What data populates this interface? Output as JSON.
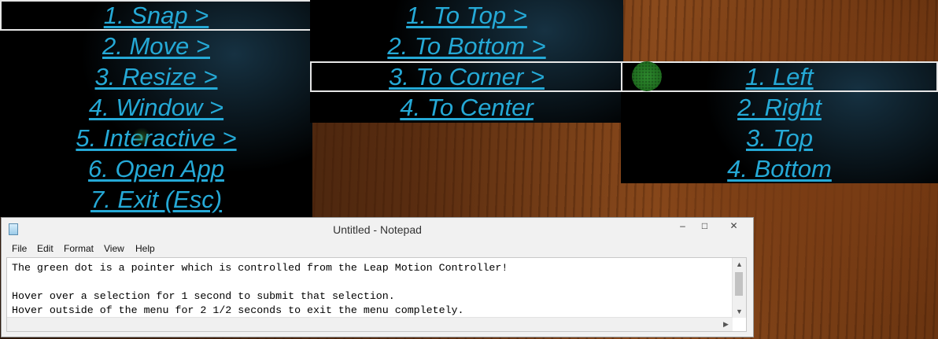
{
  "menu_level_1": {
    "items": [
      {
        "label": "1. Snap >",
        "selected": true
      },
      {
        "label": "2. Move >",
        "selected": false
      },
      {
        "label": "3. Resize >",
        "selected": false
      },
      {
        "label": "4. Window >",
        "selected": false
      },
      {
        "label": "5. Interactive >",
        "selected": false
      },
      {
        "label": "6. Open App",
        "selected": false
      },
      {
        "label": "7. Exit (Esc)",
        "selected": false
      }
    ]
  },
  "menu_level_2": {
    "items": [
      {
        "label": "1. To Top >",
        "selected": false
      },
      {
        "label": "2. To Bottom >",
        "selected": false
      },
      {
        "label": "3. To Corner >",
        "selected": true
      },
      {
        "label": "4. To Center",
        "selected": false
      }
    ]
  },
  "menu_level_3": {
    "items": [
      {
        "label": "1. Left",
        "selected": true
      },
      {
        "label": "2. Right",
        "selected": false
      },
      {
        "label": "3. Top",
        "selected": false
      },
      {
        "label": "4. Bottom",
        "selected": false
      }
    ]
  },
  "pointer": {
    "icon": "green-dot-pointer-icon",
    "color": "#1e6a1e"
  },
  "notepad": {
    "title": "Untitled - Notepad",
    "menus": [
      "File",
      "Edit",
      "Format",
      "View",
      "Help"
    ],
    "controls": {
      "minimize": "‒",
      "maximize": "□",
      "close": "✕"
    },
    "text_lines": [
      "The green dot is a pointer which is controlled from the Leap Motion Controller!",
      "",
      "Hover over a selection for 1 second to submit that selection.",
      "Hover outside of the menu for 2 1/2 seconds to exit the menu completely."
    ]
  },
  "colors": {
    "menu_text": "#25a9d6",
    "menu_bg": "#000000",
    "selection_border": "#e6e6e6"
  }
}
